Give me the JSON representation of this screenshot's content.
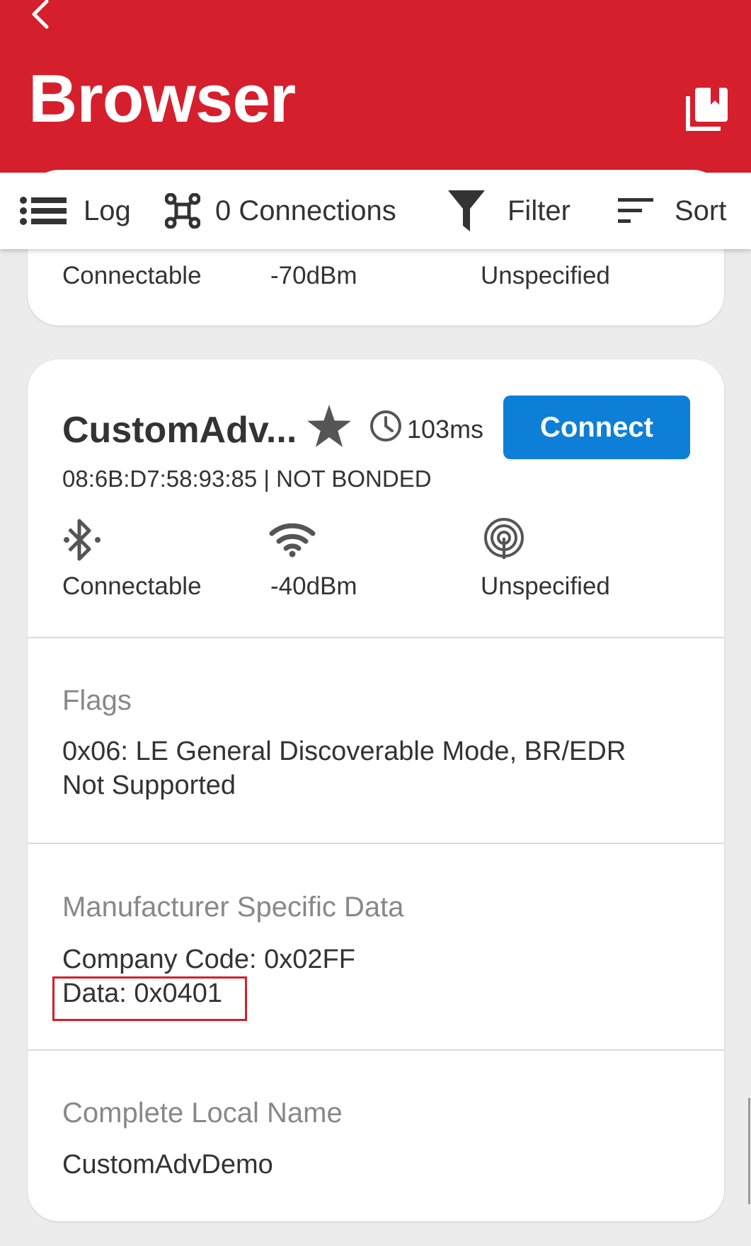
{
  "header": {
    "title": "Browser"
  },
  "toolbar": {
    "log_label": "Log",
    "connections_label": "0 Connections",
    "filter_label": "Filter",
    "sort_label": "Sort"
  },
  "previous_device": {
    "connectable_label": "Connectable",
    "rssi": "-70dBm",
    "type_label": "Unspecified"
  },
  "device": {
    "name": "CustomAdv...",
    "interval": "103ms",
    "connect_label": "Connect",
    "address": "08:6B:D7:58:93:85 | NOT BONDED",
    "connectable_label": "Connectable",
    "rssi": "-40dBm",
    "type_label": "Unspecified",
    "sections": {
      "flags": {
        "title": "Flags",
        "line1": "0x06: LE General Discoverable Mode, BR/EDR",
        "line2": "Not Supported"
      },
      "manufacturer": {
        "title": "Manufacturer Specific Data",
        "company_code": "Company Code: 0x02FF",
        "data": "Data: 0x0401"
      },
      "local_name": {
        "title": "Complete Local Name",
        "value": "CustomAdvDemo"
      }
    }
  },
  "colors": {
    "brand_red": "#d61f2c",
    "connect_blue": "#0e7fd6",
    "icon_gray": "#5f5f5f"
  }
}
